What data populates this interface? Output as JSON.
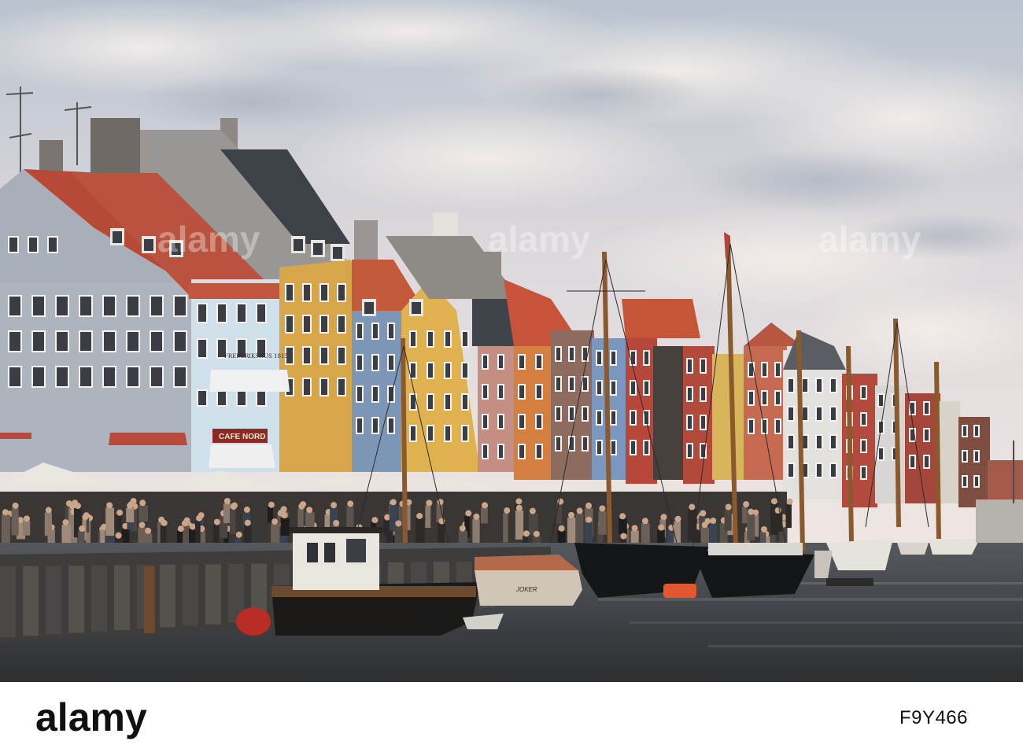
{
  "scene": {
    "description_icon": "photo-nyhavn-harbour",
    "signs": {
      "building_sign": "FREDERIKSHUS 1815",
      "cafe_sign": "CAFE NORD",
      "boat_name": "JOKER"
    }
  },
  "watermark": {
    "text": "alamy"
  },
  "footer": {
    "logo_text": "alamy",
    "image_id": "F9Y466"
  },
  "colors": {
    "sky_top": "#c9cfd8",
    "sky_bottom": "#e9e4e6",
    "water": "#3b3d40",
    "logo": "#111111"
  }
}
